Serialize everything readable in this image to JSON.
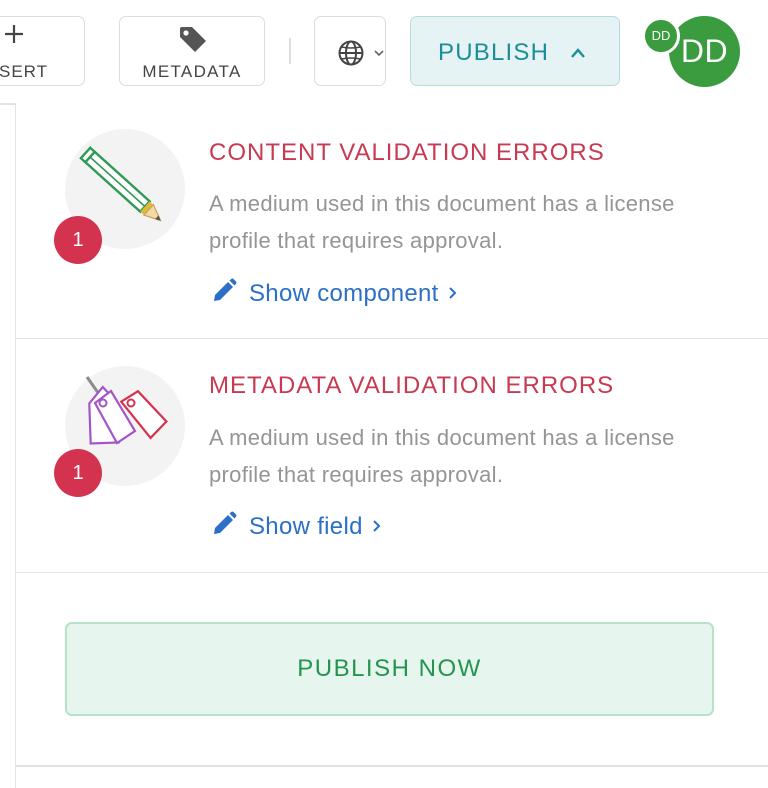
{
  "toolbar": {
    "insert_label": "SERT",
    "metadata_label": "METADATA",
    "publish_label": "PUBLISH",
    "avatar_initials": "DD",
    "avatar_badge_initials": "DD"
  },
  "errors": [
    {
      "title": "CONTENT VALIDATION ERRORS",
      "count": "1",
      "description": "A medium used in this document has a license profile that requires approval.",
      "link_label": "Show component",
      "icon": "pencil-icon"
    },
    {
      "title": "METADATA VALIDATION ERRORS",
      "count": "1",
      "description": "A medium used in this document has a license profile that requires approval.",
      "link_label": "Show field",
      "icon": "tags-icon"
    }
  ],
  "publish_now_label": "PUBLISH NOW",
  "colors": {
    "error_red": "#c83a53",
    "badge_red": "#d3334e",
    "link_blue": "#2b6fc7",
    "publish_teal": "#1b8e97",
    "publish_now_green": "#24944e",
    "avatar_green": "#3a9b3f"
  }
}
